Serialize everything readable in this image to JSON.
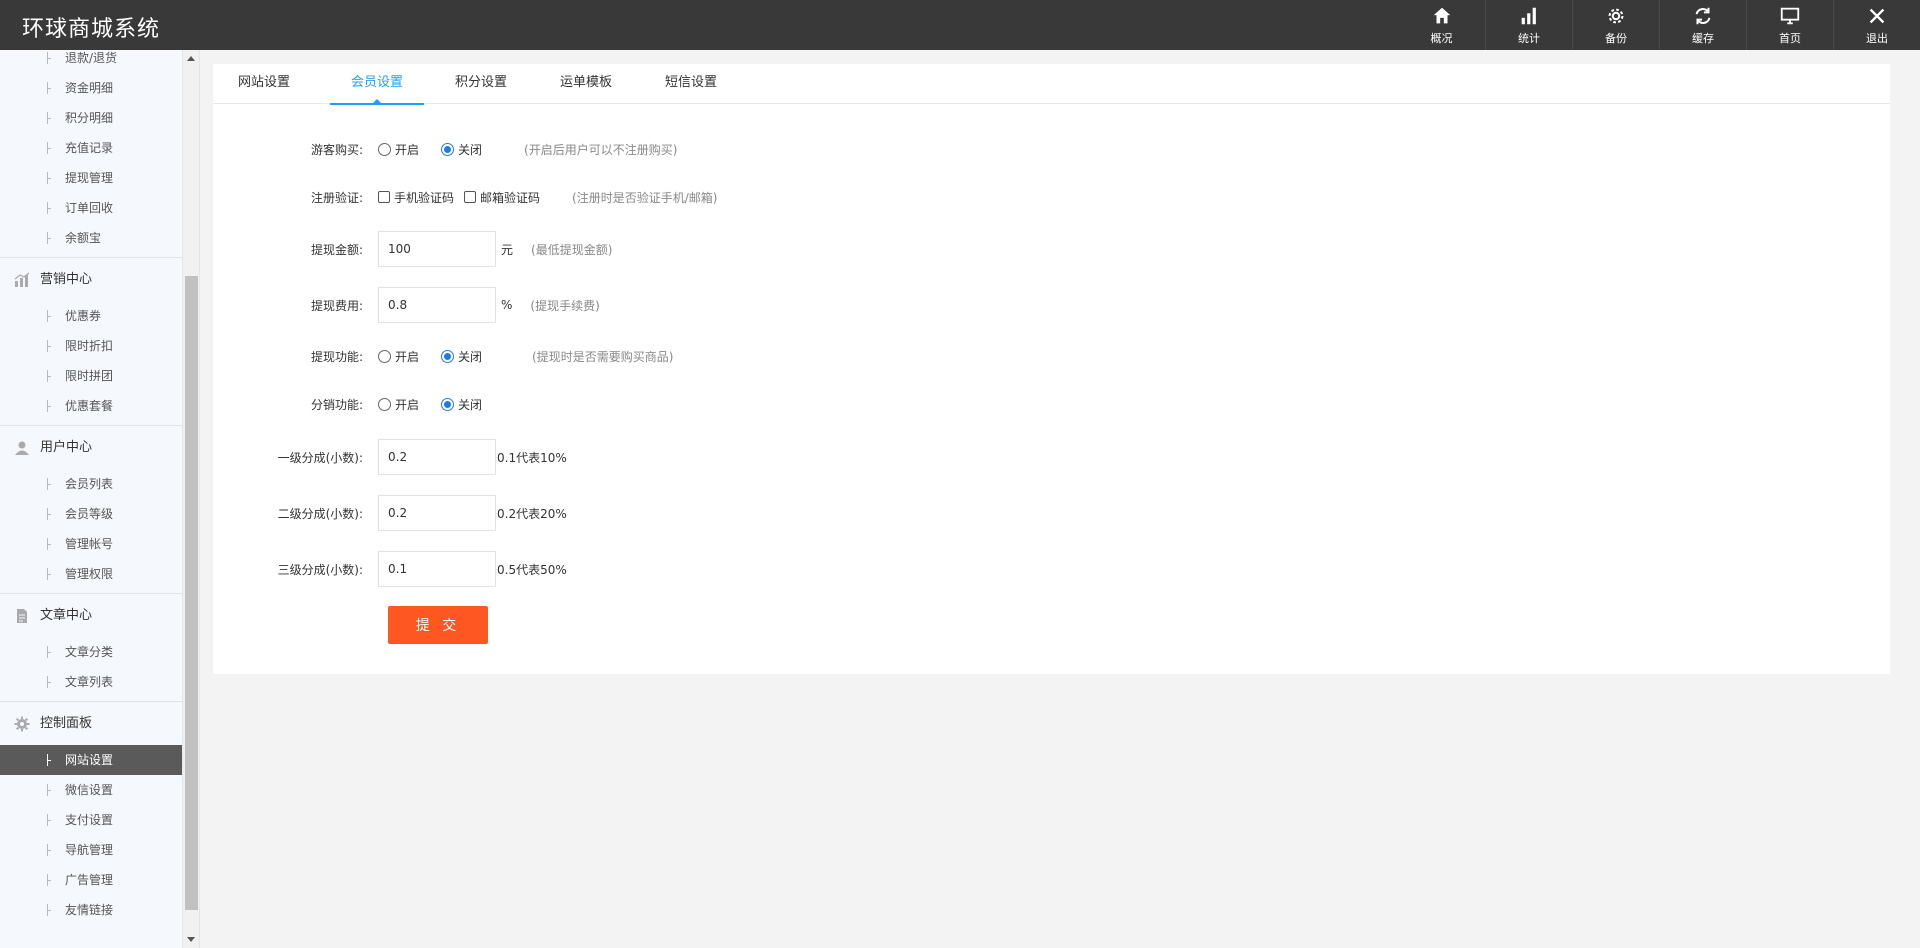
{
  "app": {
    "title": "环球商城系统"
  },
  "topnav": [
    {
      "label": "概况",
      "icon": "home-icon"
    },
    {
      "label": "统计",
      "icon": "bar-chart-icon"
    },
    {
      "label": "备份",
      "icon": "gear-icon"
    },
    {
      "label": "缓存",
      "icon": "refresh-icon"
    },
    {
      "label": "首页",
      "icon": "monitor-icon"
    },
    {
      "label": "退出",
      "icon": "close-icon"
    }
  ],
  "sidebar": {
    "top_items": [
      "退款/退货",
      "资金明细",
      "积分明细",
      "充值记录",
      "提现管理",
      "订单回收",
      "余额宝"
    ],
    "groups": [
      {
        "title": "营销中心",
        "icon": "chart-icon",
        "items": [
          "优惠券",
          "限时折扣",
          "限时拼团",
          "优惠套餐"
        ]
      },
      {
        "title": "用户中心",
        "icon": "user-icon",
        "items": [
          "会员列表",
          "会员等级",
          "管理帐号",
          "管理权限"
        ]
      },
      {
        "title": "文章中心",
        "icon": "document-icon",
        "items": [
          "文章分类",
          "文章列表"
        ]
      },
      {
        "title": "控制面板",
        "icon": "gear-icon",
        "items": [
          "网站设置",
          "微信设置",
          "支付设置",
          "导航管理",
          "广告管理",
          "友情链接"
        ],
        "active_index": 0
      }
    ]
  },
  "tabs": [
    "网站设置",
    "会员设置",
    "积分设置",
    "运单模板",
    "短信设置"
  ],
  "active_tab": "会员设置",
  "form": {
    "guest_buy": {
      "label": "游客购买:",
      "options": [
        "开启",
        "关闭"
      ],
      "selected": "关闭",
      "hint": "(开启后用户可以不注册购买)"
    },
    "register_verify": {
      "label": "注册验证:",
      "options": [
        "手机验证码",
        "邮箱验证码"
      ],
      "checked": [],
      "hint": "(注册时是否验证手机/邮箱)"
    },
    "withdraw_amount": {
      "label": "提现金额:",
      "value": "100",
      "unit": "元",
      "hint": "(最低提现金额)"
    },
    "withdraw_fee": {
      "label": "提现费用:",
      "value": "0.8",
      "unit": "%",
      "hint": "(提现手续费)"
    },
    "withdraw_function": {
      "label": "提现功能:",
      "options": [
        "开启",
        "关闭"
      ],
      "selected": "关闭",
      "hint": "(提现时是否需要购买商品)"
    },
    "distribution": {
      "label": "分销功能:",
      "options": [
        "开启",
        "关闭"
      ],
      "selected": "关闭"
    },
    "level1": {
      "label": "一级分成(小数):",
      "value": "0.2",
      "suffix": "0.1代表10%"
    },
    "level2": {
      "label": "二级分成(小数):",
      "value": "0.2",
      "suffix": "0.2代表20%"
    },
    "level3": {
      "label": "三级分成(小数):",
      "value": "0.1",
      "suffix": "0.5代表50%"
    },
    "submit_label": "提 交"
  },
  "colors": {
    "topbar": "#393939",
    "accent": "#1e9fff",
    "submit": "#ff5722",
    "sidebar_active": "#5a5a5a"
  }
}
